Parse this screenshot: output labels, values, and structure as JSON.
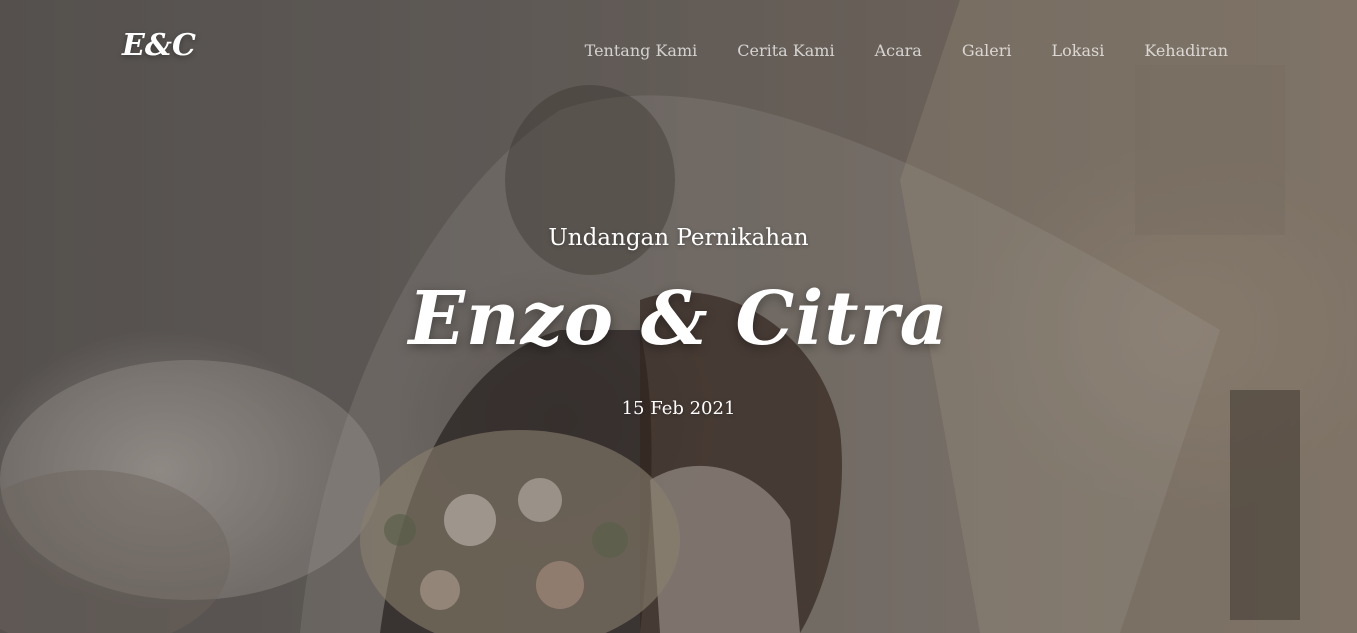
{
  "brand": {
    "logo_text": "E&C"
  },
  "nav": {
    "items": [
      {
        "label": "Tentang Kami"
      },
      {
        "label": "Cerita Kami"
      },
      {
        "label": "Acara"
      },
      {
        "label": "Galeri"
      },
      {
        "label": "Lokasi"
      },
      {
        "label": "Kehadiran"
      }
    ]
  },
  "hero": {
    "subtitle": "Undangan Pernikahan",
    "couple_names": "Enzo & Citra",
    "date": "15 Feb 2021"
  },
  "colors": {
    "text": "#ffffff",
    "nav_text": "rgba(255,255,255,0.72)",
    "overlay": "rgba(40,36,35,0.32)"
  }
}
